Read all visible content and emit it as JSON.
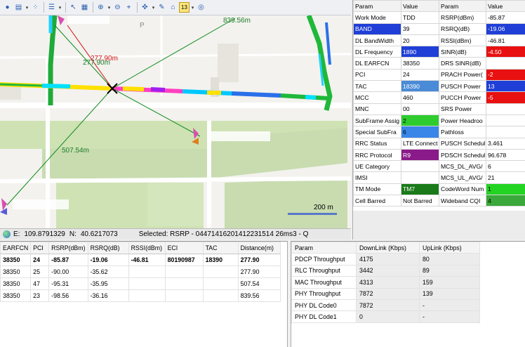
{
  "toolbar": {
    "icons": [
      "globe-icon",
      "open-folder-icon",
      "network-icon",
      "layers-icon",
      "pointer-icon",
      "select-region-icon",
      "zoom-in-icon",
      "zoom-out-icon",
      "fit-icon",
      "pan-icon",
      "pin-icon",
      "measure-icon",
      "legend-icon",
      "binoculars-icon"
    ],
    "legend_number": "13"
  },
  "map": {
    "distance_labels": {
      "a": "839.56m",
      "b": "277.90m",
      "c": "277.90m",
      "d": "507.54m"
    },
    "scale_text": "200 m",
    "poi_letter": "P"
  },
  "status": {
    "east_label": "E:",
    "east": "109.8791329",
    "north_label": "N:",
    "north": "40.6217073",
    "selected": "Selected:  RSRP - 04471416201412231514 26ms3 - Q"
  },
  "params": {
    "headers": [
      "Param",
      "Value",
      "Param",
      "Value"
    ],
    "rows": [
      [
        "Work Mode",
        "TDD",
        "RSRP(dBm)",
        "-85.87"
      ],
      [
        "BAND",
        "39",
        "RSRQ(dB)",
        "-19.06"
      ],
      [
        "DL BandWidth",
        "20",
        "RSSI(dBm)",
        "-46.81"
      ],
      [
        "DL Frequency",
        "1890",
        "SINR(dB)",
        "-4.50"
      ],
      [
        "DL EARFCN",
        "38350",
        "DRS SINR(dB)",
        ""
      ],
      [
        "PCI",
        "24",
        "PRACH Power(",
        "-2"
      ],
      [
        "TAC",
        "18390",
        "PUSCH Power",
        "13"
      ],
      [
        "MCC",
        "460",
        "PUCCH Power",
        "-5"
      ],
      [
        "MNC",
        "00",
        "SRS Power",
        ""
      ],
      [
        "SubFrame Assig",
        "2",
        "Power Headroo",
        ""
      ],
      [
        "Special SubFra",
        "6",
        "Pathloss",
        ""
      ],
      [
        "RRC Status",
        "LTE Connect",
        "PUSCH Schedul",
        "3.461"
      ],
      [
        "RRC Protocol",
        "R9",
        "PDSCH Schedul",
        "96.678"
      ],
      [
        "UE Category",
        "",
        "MCS_DL_AVG/",
        "6"
      ],
      [
        "IMSI",
        "",
        "MCS_UL_AVG/",
        "21"
      ],
      [
        "TM Mode",
        "TM7",
        "CodeWord Num",
        "1"
      ],
      [
        "Cell Barred",
        "Not Barred",
        "Wideband CQI",
        "4"
      ]
    ],
    "cell_colors": {
      "1_0": "#1f3fd6",
      "1_3": "#1f3fd6",
      "3_1": "#1f3fd6",
      "3_3": "#e81010",
      "5_3": "#e81010",
      "6_1": "#4a8bd8",
      "6_3": "#1f3fd6",
      "7_3": "#e81010",
      "9_1": "#2fcc2f",
      "10_1": "#3a86e8",
      "12_1": "#8a1a8a",
      "15_1": "#1a7a1a",
      "15_3": "#23d423",
      "16_3": "#3aa83a"
    },
    "white_text_cells": [
      "1_0",
      "1_3",
      "3_1",
      "3_3",
      "5_3",
      "6_1",
      "6_3",
      "7_3",
      "12_1",
      "15_1"
    ]
  },
  "cells": {
    "headers": [
      "EARFCN",
      "PCI",
      "RSRP(dBm)",
      "RSRQ(dB)",
      "RSSI(dBm)",
      "ECI",
      "TAC",
      "Distance(m)"
    ],
    "rows": [
      [
        "38350",
        "24",
        "-85.87",
        "-19.06",
        "-46.81",
        "80190987",
        "18390",
        "277.90"
      ],
      [
        "38350",
        "25",
        "-90.00",
        "-35.62",
        "",
        "",
        "",
        "277.90"
      ],
      [
        "38350",
        "47",
        "-95.31",
        "-35.95",
        "",
        "",
        "",
        "507.54"
      ],
      [
        "38350",
        "23",
        "-98.56",
        "-36.16",
        "",
        "",
        "",
        "839.56"
      ]
    ]
  },
  "throughput": {
    "headers": [
      "Param",
      "DownLink (Kbps)",
      "UpLink (Kbps)"
    ],
    "rows": [
      [
        "PDCP Throughput",
        "4175",
        "80"
      ],
      [
        "RLC Throughput",
        "3442",
        "89"
      ],
      [
        "MAC Throughput",
        "4313",
        "159"
      ],
      [
        "PHY Throughput",
        "7872",
        "139"
      ],
      [
        "PHY DL Code0",
        "7872",
        "-"
      ],
      [
        "PHY DL Code1",
        "0",
        "-"
      ]
    ]
  }
}
